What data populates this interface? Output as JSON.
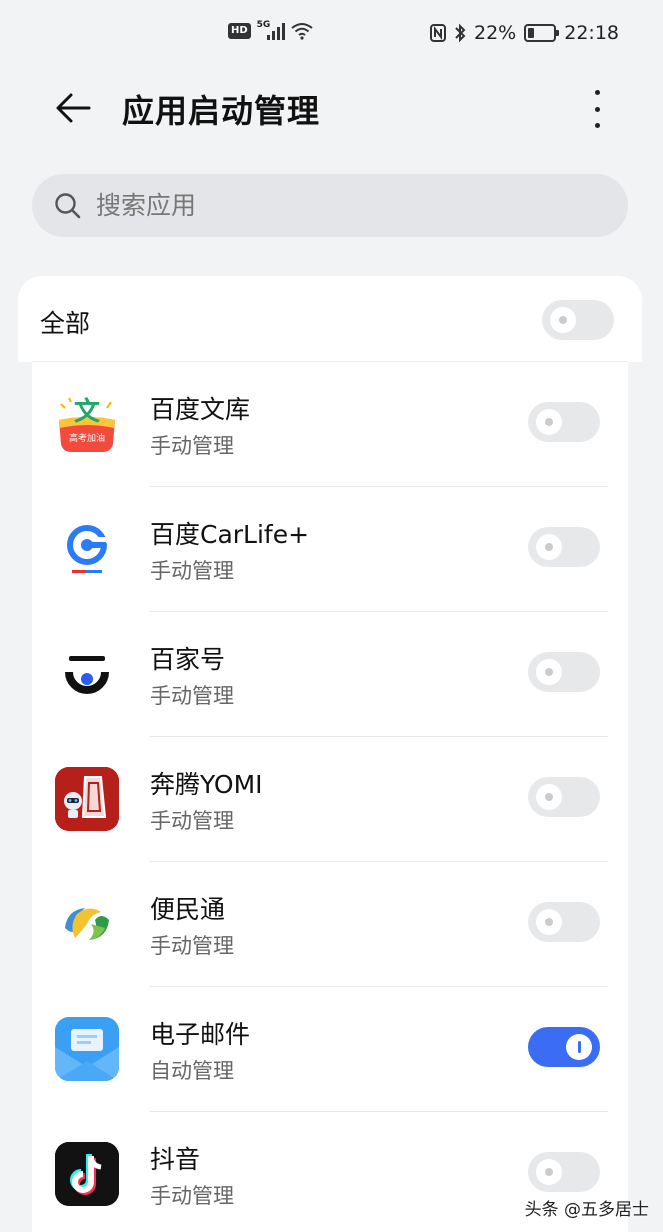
{
  "status_bar": {
    "hd": "HD",
    "network": "5G",
    "battery_percent": "22%",
    "battery_level": 0.22,
    "time": "22:18"
  },
  "header": {
    "title": "应用启动管理"
  },
  "search": {
    "placeholder": "搜索应用"
  },
  "all_toggle": {
    "label": "全部",
    "on": false
  },
  "apps": [
    {
      "name": "百度文库",
      "mode": "手动管理",
      "on": false,
      "icon": "baidu-wenku-icon"
    },
    {
      "name": "百度CarLife+",
      "mode": "手动管理",
      "on": false,
      "icon": "carlife-icon"
    },
    {
      "name": "百家号",
      "mode": "手动管理",
      "on": false,
      "icon": "baijiahao-icon"
    },
    {
      "name": "奔腾YOMI",
      "mode": "手动管理",
      "on": false,
      "icon": "yomi-icon"
    },
    {
      "name": "便民通",
      "mode": "手动管理",
      "on": false,
      "icon": "bianmintong-icon"
    },
    {
      "name": "电子邮件",
      "mode": "自动管理",
      "on": true,
      "icon": "email-icon"
    },
    {
      "name": "抖音",
      "mode": "手动管理",
      "on": false,
      "icon": "douyin-icon"
    }
  ],
  "icon_text": {
    "wenku_char": "文",
    "wenku_banner": "高考加油"
  },
  "watermark": "头条 @五多居士",
  "colors": {
    "accent": "#3a6cf4",
    "background": "#f1f3f5"
  }
}
